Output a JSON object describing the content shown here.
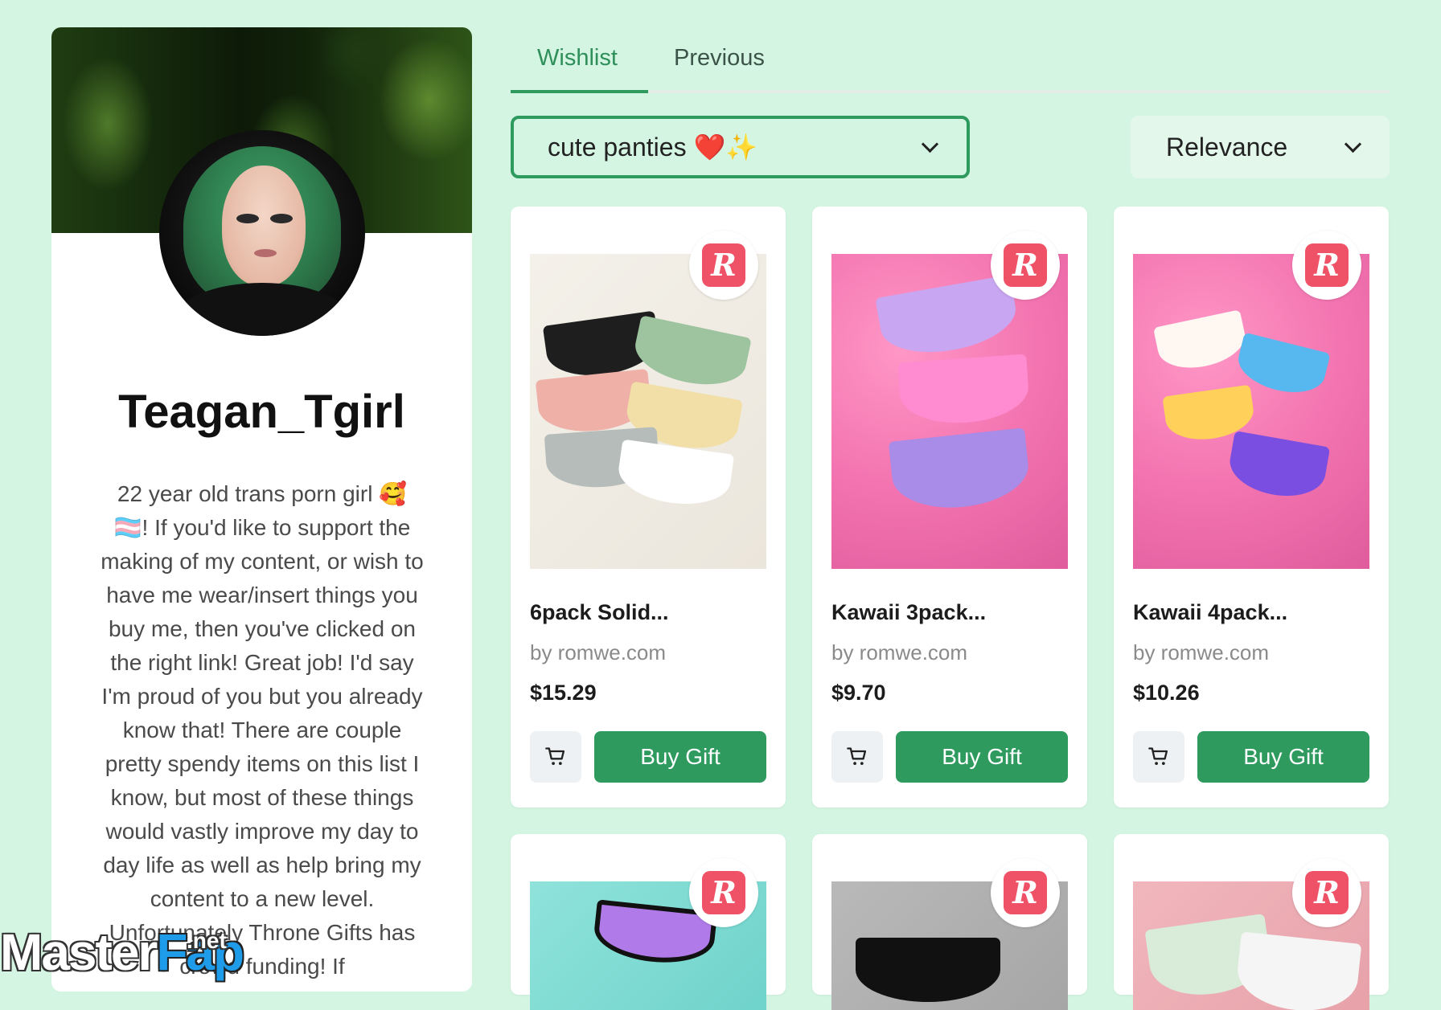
{
  "profile": {
    "username": "Teagan_Tgirl",
    "bio": "22 year old trans porn girl 🥰 🏳️‍⚧️! If you'd like to support the making of my content, or wish to have me wear/insert things you buy me, then you've clicked on the right link! Great job! I'd say I'm proud of you but you already know that! There are couple pretty spendy items on this list I know, but most of these things would vastly improve my day to day life as well as help bring my content to a new level. Unfortunately Throne Gifts has crowd funding! If"
  },
  "tabs": [
    {
      "label": "Wishlist",
      "active": true
    },
    {
      "label": "Previous",
      "active": false
    }
  ],
  "filters": {
    "list_selected": "cute panties ❤️✨",
    "sort_selected": "Relevance"
  },
  "colors": {
    "background": "#d5f5e3",
    "accent": "#2e9a5e",
    "store_badge": "#ef5266"
  },
  "icons": {
    "store_badge": "romwe-r-icon",
    "cart": "cart-icon",
    "chevron": "chevron-down-icon"
  },
  "store_badge_letter": "R",
  "products": [
    {
      "title": "6pack Solid...",
      "seller": "by romwe.com",
      "price": "$15.29",
      "buy_label": "Buy Gift"
    },
    {
      "title": "Kawaii 3pack...",
      "seller": "by romwe.com",
      "price": "$9.70",
      "buy_label": "Buy Gift"
    },
    {
      "title": "Kawaii 4pack...",
      "seller": "by romwe.com",
      "price": "$10.26",
      "buy_label": "Buy Gift"
    },
    {
      "title": "",
      "seller": "",
      "price": "",
      "buy_label": ""
    },
    {
      "title": "",
      "seller": "",
      "price": "",
      "buy_label": ""
    },
    {
      "title": "",
      "seller": "",
      "price": "",
      "buy_label": ""
    }
  ],
  "watermark": {
    "part1": "Master",
    "part2": "Fap",
    "suffix": ".net"
  }
}
